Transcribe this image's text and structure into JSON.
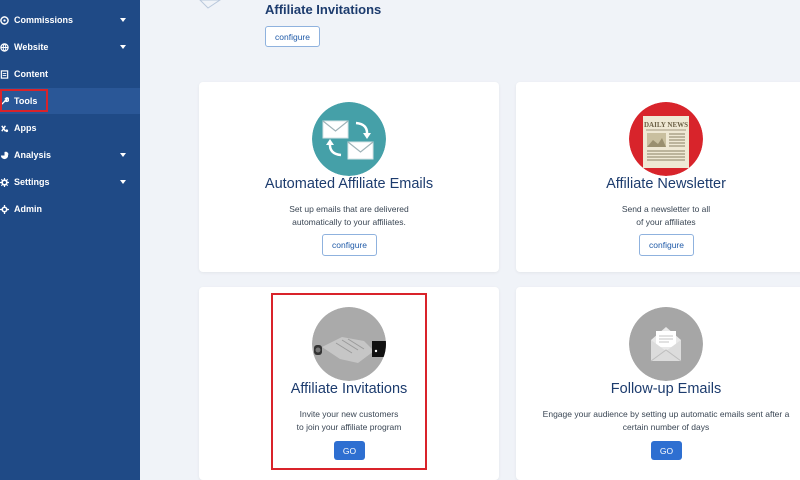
{
  "sidebar": {
    "items": [
      {
        "label": "Commissions",
        "icon": "commissions-icon",
        "has_caret": true
      },
      {
        "label": "Website",
        "icon": "globe-icon",
        "has_caret": true
      },
      {
        "label": "Content",
        "icon": "content-icon",
        "has_caret": false
      },
      {
        "label": "Tools",
        "icon": "tools-icon",
        "has_caret": false,
        "active": true
      },
      {
        "label": "Apps",
        "icon": "apps-icon",
        "has_caret": false
      },
      {
        "label": "Analysis",
        "icon": "analysis-icon",
        "has_caret": true
      },
      {
        "label": "Settings",
        "icon": "gear-icon",
        "has_caret": true
      },
      {
        "label": "Admin",
        "icon": "admin-icon",
        "has_caret": false
      }
    ]
  },
  "top": {
    "title": "Affiliate Invitations",
    "button": "configure"
  },
  "cards": [
    {
      "title": "Automated Affiliate Emails",
      "desc_lines": [
        "Set up emails that are delivered",
        "automatically to your affiliates."
      ],
      "button": "configure",
      "icon": "email-exchange-icon",
      "circle_color": "#45a0a8"
    },
    {
      "title": "Affiliate Newsletter",
      "desc_lines": [
        "Send a newsletter to all",
        "of your affiliates"
      ],
      "button": "configure",
      "icon": "newspaper-icon",
      "newspaper_text": "DAILY NEWS",
      "circle_color": "#d8242b"
    },
    {
      "title": "Affiliate Invitations",
      "desc_lines": [
        "Invite your new customers",
        "to join your affiliate program"
      ],
      "button": "GO",
      "icon": "handshake-icon",
      "circle_color": "#aaaaaa"
    },
    {
      "title": "Follow-up Emails",
      "desc_lines": [
        "Engage your audience by setting up automatic emails sent after a",
        "certain number of days"
      ],
      "button": "GO",
      "icon": "envelope-icon",
      "circle_color": "#a6a6a6"
    }
  ],
  "colors": {
    "sidebar": "#1f4a86",
    "accent": "#2e6fd1",
    "highlight": "#d9232a",
    "title": "#1d3c6e"
  }
}
